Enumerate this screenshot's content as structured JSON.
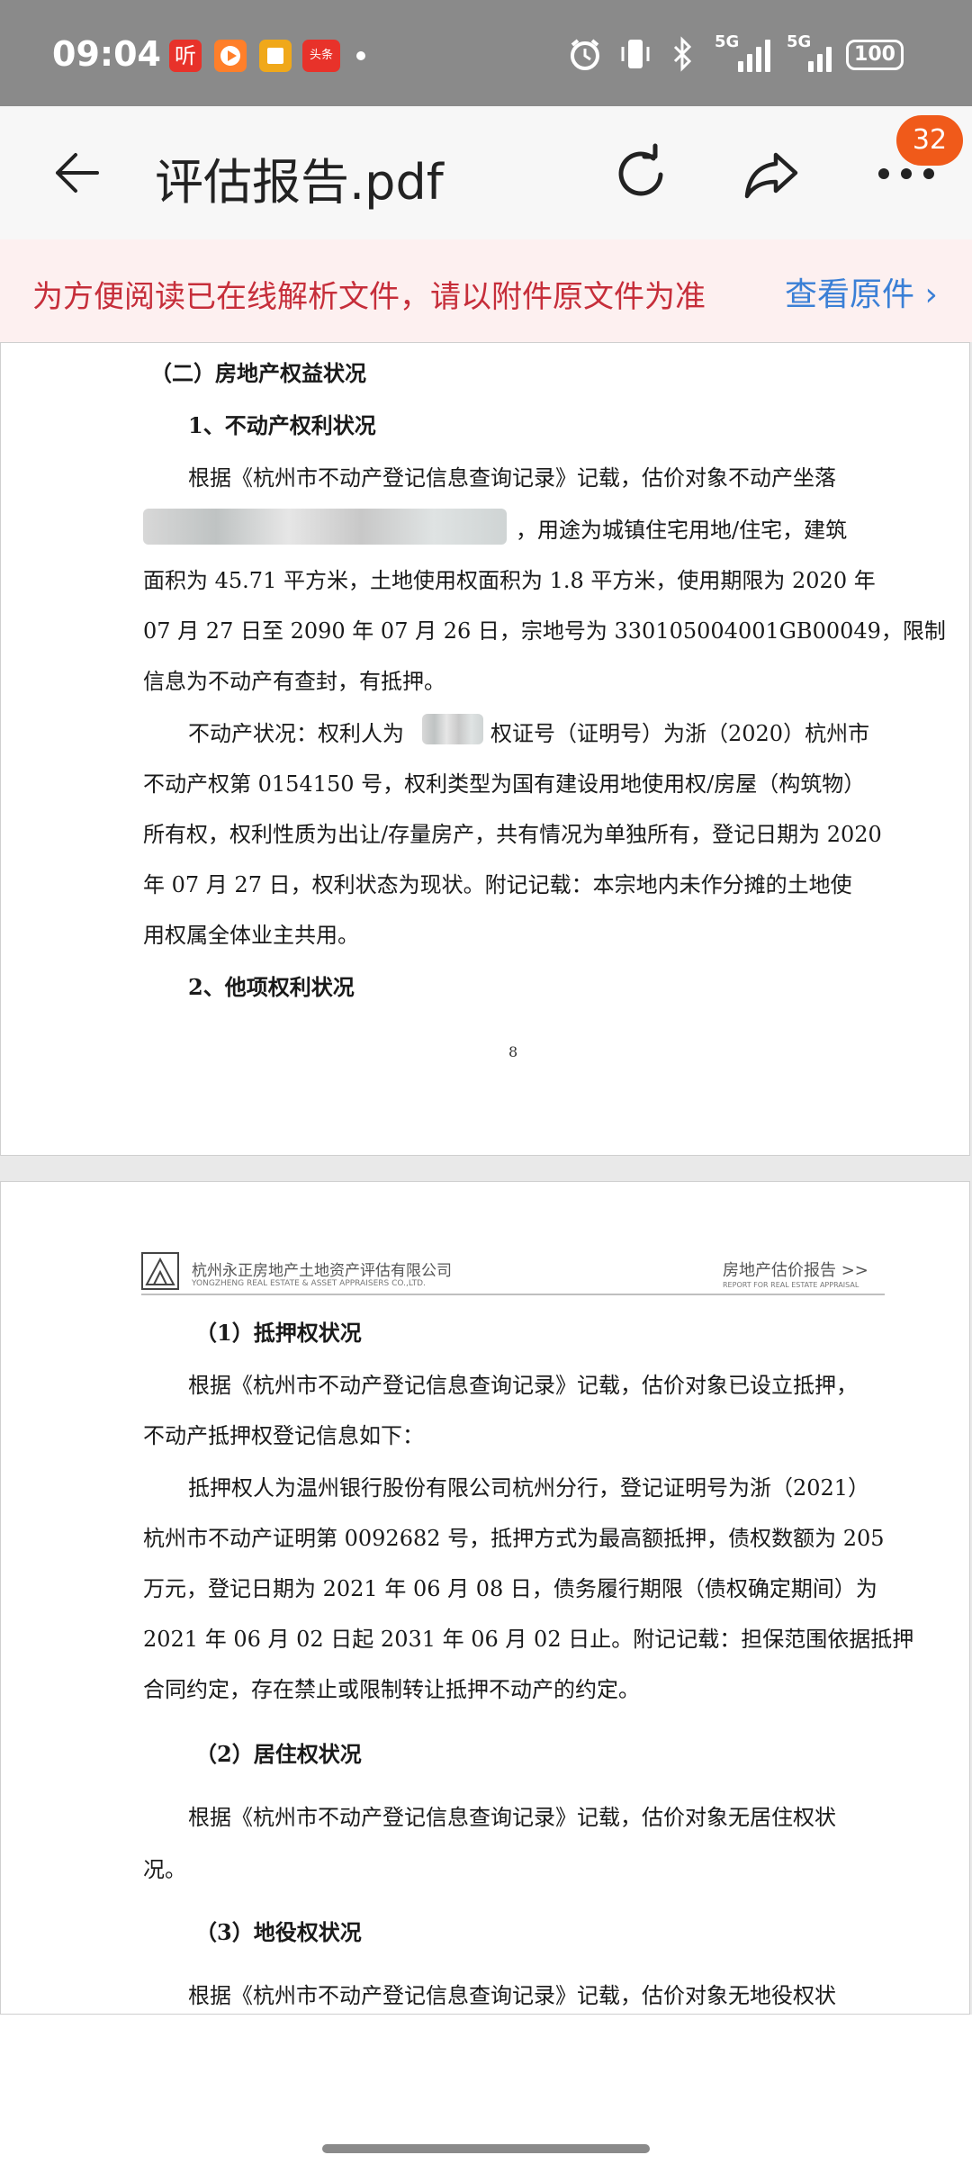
{
  "status_bar": {
    "time": "09:04",
    "apps": [
      {
        "name": "ting-app",
        "label": "听",
        "color": "#e8322a"
      },
      {
        "name": "video-app",
        "label": "",
        "color": "#ff7f2a"
      },
      {
        "name": "reader-app",
        "label": "",
        "color": "#f0a81a"
      },
      {
        "name": "toutiao-app",
        "label": "头条",
        "color": "#e8322a"
      }
    ],
    "signal_label_1": "5G",
    "signal_label_2": "5G",
    "battery": "100"
  },
  "header": {
    "title": "评估报告.pdf",
    "badge_count": "32"
  },
  "notice": {
    "text": "为方便阅读已在线解析文件，请以附件原文件为准",
    "link": "查看原件"
  },
  "page1": {
    "section_title": "（二）房地产权益状况",
    "subsection_1": "1、不动产权利状况",
    "para1_line1": "根据《杭州市不动产登记信息查询记录》记载，估价对象不动产坐落",
    "para1_line2_tail": "，用途为城镇住宅用地/住宅，建筑",
    "para1_line3": "面积为 45.71 平方米，土地使用权面积为 1.8 平方米，使用期限为 2020 年",
    "para1_line4": "07 月 27 日至 2090 年 07 月 26 日，宗地号为 330105004001GB00049，限制",
    "para1_line5": "信息为不动产有查封，有抵押。",
    "para2_line1a": "不动产状况：权利人为",
    "para2_line1b": "权证号（证明号）为浙（2020）杭州市",
    "para2_line2": "不动产权第 0154150 号，权利类型为国有建设用地使用权/房屋（构筑物）",
    "para2_line3": "所有权，权利性质为出让/存量房产，共有情况为单独所有，登记日期为 2020",
    "para2_line4": "年 07 月 27 日，权利状态为现状。附记记载：本宗地内未作分摊的土地使",
    "para2_line5": "用权属全体业主共用。",
    "subsection_2": "2、他项权利状况",
    "page_number": "8"
  },
  "page2": {
    "header_company": "杭州永正房地产土地资产评估有限公司",
    "header_company_en": "YONGZHENG REAL ESTATE & ASSET APPRAISERS CO.,LTD.",
    "header_report": "房地产估价报告 >>",
    "header_report_en": "REPORT FOR REAL ESTATE APPRAISAL",
    "heading_1": "（1）抵押权状况",
    "p1_line1": "根据《杭州市不动产登记信息查询记录》记载，估价对象已设立抵押，",
    "p1_line2": "不动产抵押权登记信息如下：",
    "p2_line1": "抵押权人为温州银行股份有限公司杭州分行，登记证明号为浙（2021）",
    "p2_line2": "杭州市不动产证明第 0092682 号，抵押方式为最高额抵押，债权数额为 205",
    "p2_line3": "万元，登记日期为 2021 年 06 月 08 日，债务履行期限（债权确定期间）为",
    "p2_line4": "2021 年 06 月 02 日起 2031 年 06 月 02 日止。附记记载：担保范围依据抵押",
    "p2_line5": "合同约定，存在禁止或限制转让抵押不动产的约定。",
    "heading_2": "（2）居住权状况",
    "p3_line1": "根据《杭州市不动产登记信息查询记录》记载，估价对象无居住权状",
    "p3_line2": "况。",
    "heading_3": "（3）地役权状况",
    "p4_line1": "根据《杭州市不动产登记信息查询记录》记载，估价对象无地役权状"
  }
}
